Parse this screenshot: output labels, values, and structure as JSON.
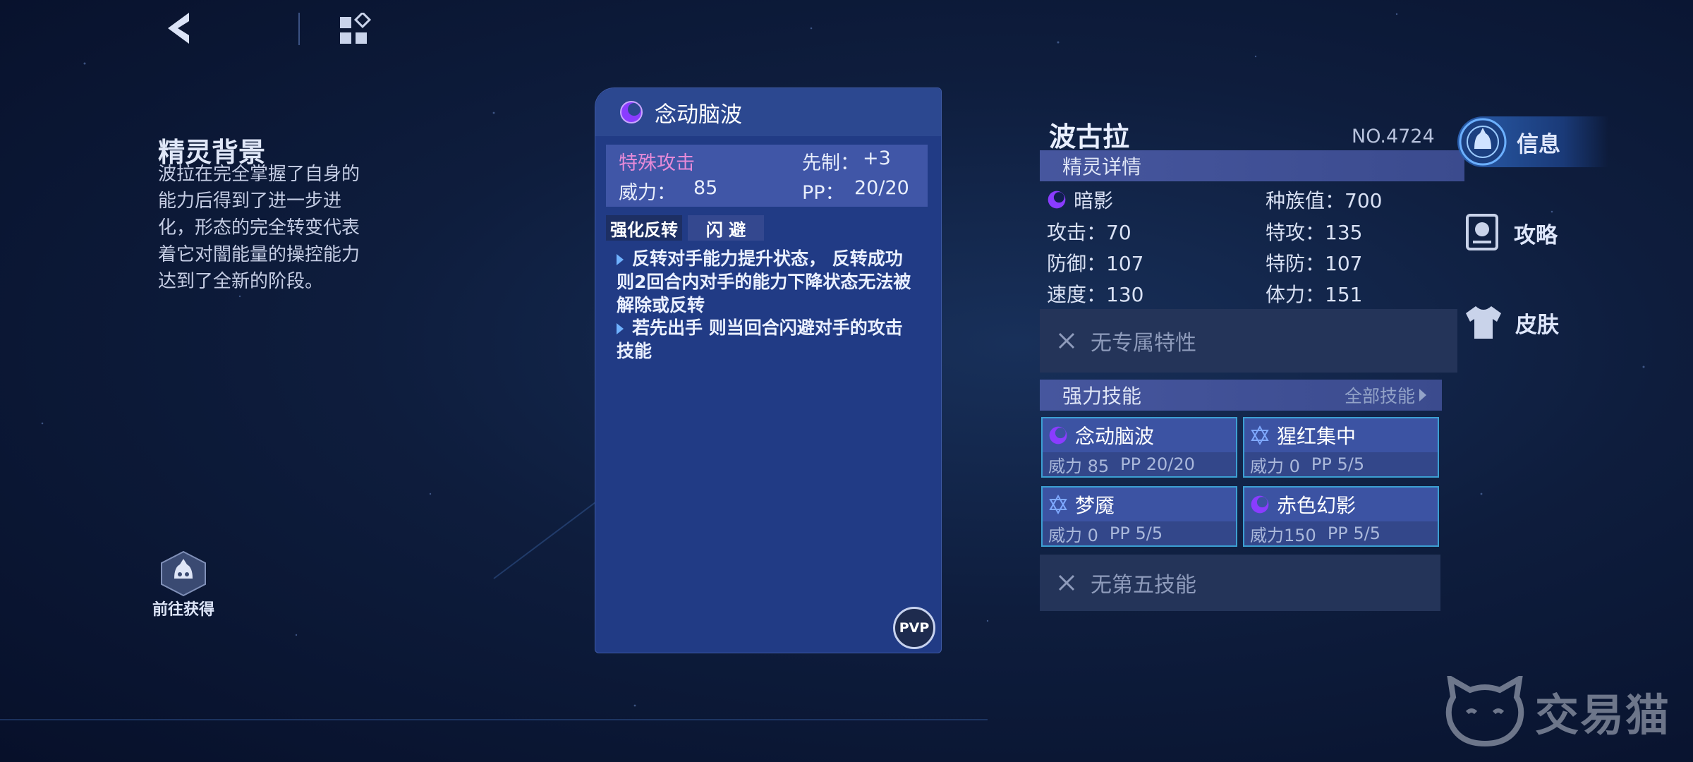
{
  "toolbar": {
    "back": "back-icon",
    "menu": "grid-menu-icon"
  },
  "background": {
    "title": "精灵背景",
    "text": "波拉在完全掌握了自身的能力后得到了进一步进化，形态的完全转变代表着它对闇能量的操控能力达到了全新的阶段。"
  },
  "obtain_label": "前往获得",
  "skill_card": {
    "name": "念动脑波",
    "category": "特殊攻击",
    "priority_label": "先制：",
    "priority": "+3",
    "power_label": "威力：",
    "power": "85",
    "pp_label": "PP：",
    "pp": "20/20",
    "tags": [
      "强化反转",
      "闪 避"
    ],
    "desc1": "反转对手能力提升状态， 反转成功 则2回合内对手的能力下降状态无法被解除或反转",
    "desc2": "若先出手 则当回合闪避对手的攻击技能",
    "pvp": "PVP"
  },
  "pet": {
    "name": "波古拉",
    "number": "NO.4724",
    "details_label": "精灵详情",
    "type": "暗影",
    "attrs": {
      "base_total": "种族值：700",
      "attack": "攻击：70",
      "sp_attack": "特攻：135",
      "defense": "防御：107",
      "sp_defense": "特防：107",
      "speed": "速度：130",
      "hp": "体力：151"
    },
    "trait": "无专属特性",
    "skills_label": "强力技能",
    "all_skills": "全部技能",
    "skills": [
      {
        "name": "念动脑波",
        "power": "威力 85",
        "pp": "PP 20/20"
      },
      {
        "name": "猩红集中",
        "power": "威力  0",
        "pp": "PP    5/5"
      },
      {
        "name": "梦魇",
        "power": "威力  0",
        "pp": "PP    5/5"
      },
      {
        "name": "赤色幻影",
        "power": "威力150",
        "pp": "PP    5/5"
      }
    ],
    "fifth_skill": "无第五技能"
  },
  "tabs": {
    "info": "信息",
    "guide": "攻略",
    "skin": "皮肤"
  },
  "watermark": "交易猫",
  "colors": {
    "shadow_purple": "#8a3cff",
    "card_bg": "#213b85",
    "accent_blue": "#3c9fd2",
    "category_pink": "#e68ad8"
  }
}
